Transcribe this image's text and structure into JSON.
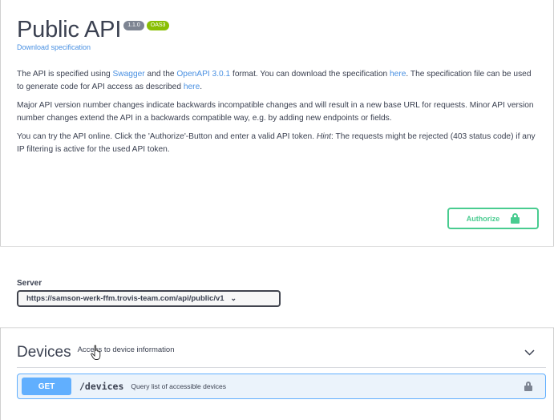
{
  "info": {
    "title": "Public API",
    "version_badge": "1.1.0",
    "oas_badge": "OAS3",
    "download_link": "Download specification"
  },
  "description": {
    "p1_a": "The API is specified using ",
    "p1_link_swagger": "Swagger",
    "p1_b": " and the ",
    "p1_link_openapi": "OpenAPI 3.0.1",
    "p1_c": " format. You can download the specification ",
    "p1_link_here1": "here",
    "p1_d": ". The specification file can be used to generate code for API access as described ",
    "p1_link_here2": "here",
    "p1_e": ".",
    "p2": "Major API version number changes indicate backwards incompatible changes and will result in a new base URL for requests. Minor API version number changes extend the API in a backwards compatible way, e.g. by adding new endpoints or fields.",
    "p3_a": "You can try the API online. Click the 'Authorize'-Button and enter a valid API token. ",
    "p3_hint": "Hint",
    "p3_b": ": The requests might be rejected (403 status code) if any IP filtering is active for the used API token."
  },
  "authorize": {
    "label": "Authorize",
    "icon": "lock-icon",
    "color": "#49cc90"
  },
  "server": {
    "label": "Server",
    "selected": "https://samson-werk-ffm.trovis-team.com/api/public/v1"
  },
  "tags": [
    {
      "name": "Devices",
      "description": "Access to device information",
      "operations": [
        {
          "method": "GET",
          "path": "/devices",
          "summary": "Query list of accessible devices"
        }
      ]
    }
  ],
  "colors": {
    "get": "#61affe",
    "link": "#4990e2",
    "oas": "#89bf04",
    "version": "#7d8492"
  }
}
